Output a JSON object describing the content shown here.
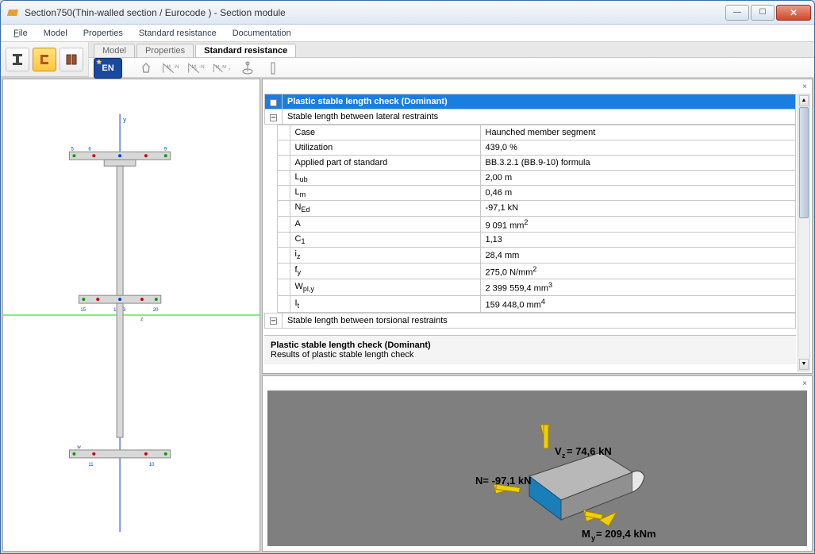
{
  "window": {
    "title": "Section750(Thin-walled section  / Eurocode )  - Section module"
  },
  "menu": {
    "file": "File",
    "model": "Model",
    "properties": "Properties",
    "standard_resistance": "Standard resistance",
    "documentation": "Documentation"
  },
  "toolbar": {
    "tabs": {
      "model": "Model",
      "properties": "Properties",
      "standard_resistance": "Standard resistance"
    },
    "en_label": "EN"
  },
  "props": {
    "section_title": "Plastic stable length check (Dominant)",
    "sub1": "Stable length between lateral restraints",
    "rows": [
      {
        "k": "Case",
        "v": "Haunched member segment"
      },
      {
        "k": "Utilization",
        "v": "439,0 %"
      },
      {
        "k": "Applied part of standard",
        "v": "BB.3.2.1 (BB.9-10) formula"
      },
      {
        "k": "L",
        "ksub": "ub",
        "v": "2,00 m"
      },
      {
        "k": "L",
        "ksub": "m",
        "v": "0,46 m"
      },
      {
        "k": "N",
        "ksub": "Ed",
        "v": "-97,1 kN"
      },
      {
        "k": "A",
        "v": "9 091 mm",
        "vsup": "2"
      },
      {
        "k": "C",
        "ksub": "1",
        "v": "1,13"
      },
      {
        "k": "i",
        "ksub": "z",
        "v": "28,4 mm"
      },
      {
        "k": "f",
        "ksub": "y",
        "v": "275,0 N/mm",
        "vsup": "2"
      },
      {
        "k": "W",
        "ksub": "pl,y",
        "v": "2 399 559,4 mm",
        "vsup": "3"
      },
      {
        "k": "I",
        "ksub": "t",
        "v": "159 448,0 mm",
        "vsup": "4"
      }
    ],
    "sub2": "Stable length between torsional restraints",
    "summary_title": "Plastic stable length check (Dominant)",
    "summary_text": "Results of plastic stable length check"
  },
  "forces": {
    "N": "N= -97,1 kN",
    "Vz": "Vz= 74,6 kN",
    "My": "My= 209,4 kNm"
  }
}
